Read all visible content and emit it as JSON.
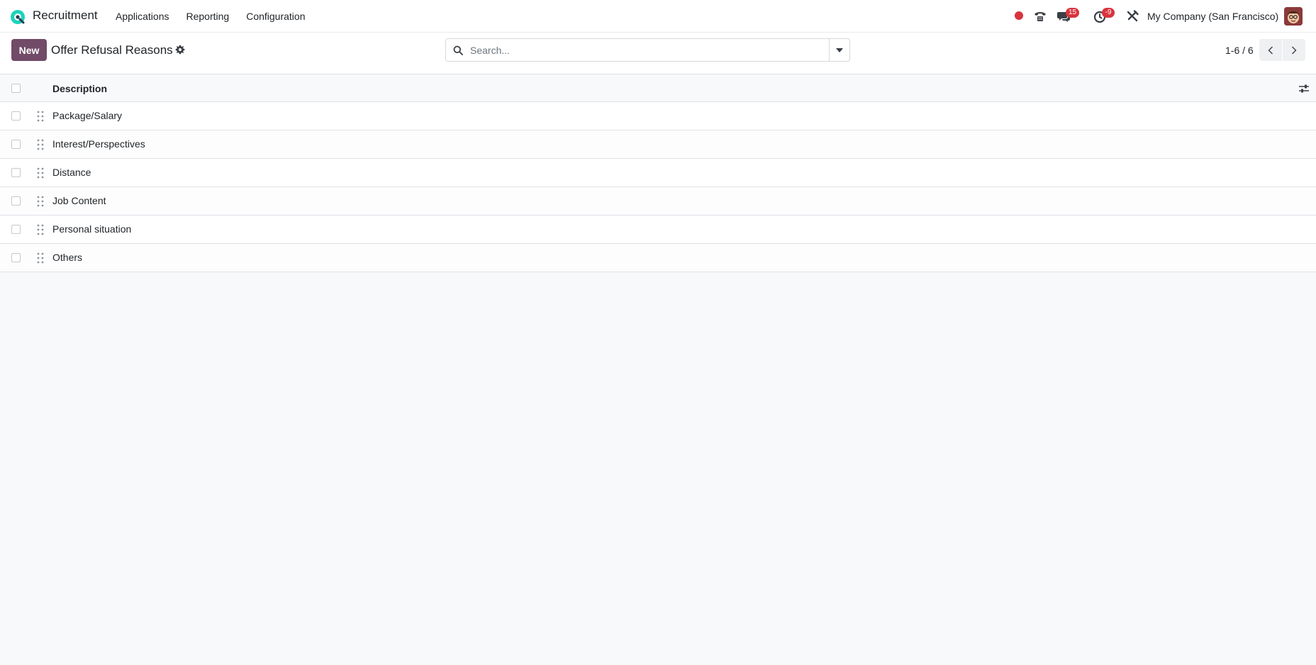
{
  "navbar": {
    "app_name": "Recruitment",
    "menu": [
      {
        "label": "Applications"
      },
      {
        "label": "Reporting"
      },
      {
        "label": "Configuration"
      }
    ],
    "messages_badge": "15",
    "activities_badge": "-9",
    "company": "My Company (San Francisco)"
  },
  "control": {
    "new_label": "New",
    "title": "Offer Refusal Reasons",
    "search_placeholder": "Search...",
    "pager": "1-6 / 6"
  },
  "list": {
    "column": "Description",
    "rows": [
      {
        "description": "Package/Salary"
      },
      {
        "description": "Interest/Perspectives"
      },
      {
        "description": "Distance"
      },
      {
        "description": "Job Content"
      },
      {
        "description": "Personal situation"
      },
      {
        "description": "Others"
      }
    ]
  },
  "colors": {
    "brand": "#714b67",
    "badge": "#d9343d",
    "logo_teal": "#1ad3bb"
  }
}
